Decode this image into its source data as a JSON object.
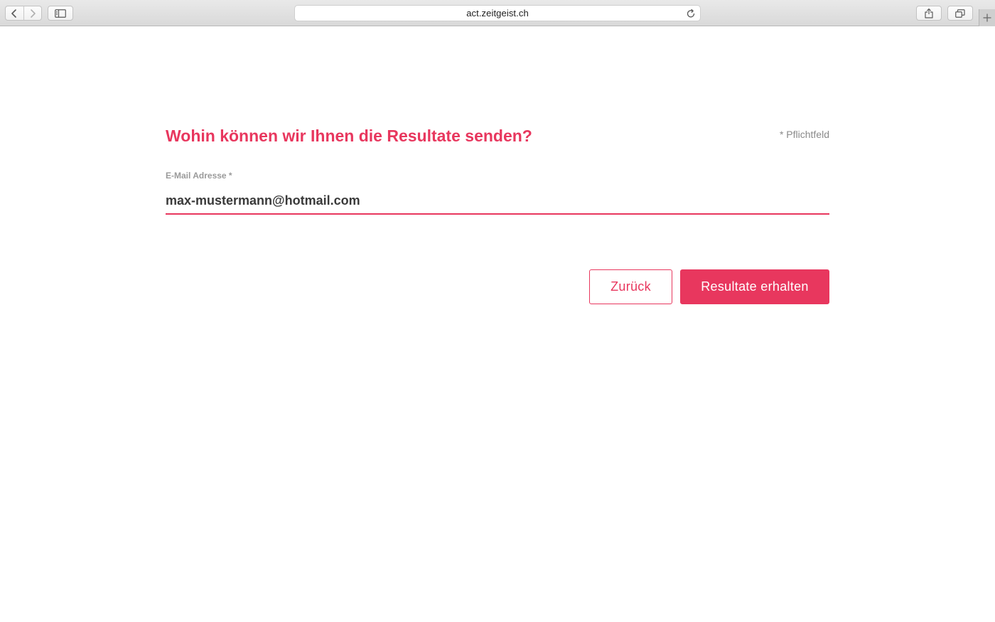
{
  "browser": {
    "url": "act.zeitgeist.ch"
  },
  "form": {
    "question": "Wohin können wir Ihnen die Resultate senden?",
    "required_note": "* Pflichtfeld",
    "email_label": "E-Mail Adresse *",
    "email_value": "max-mustermann@hotmail.com",
    "back_label": "Zurück",
    "submit_label": "Resultate erhalten"
  },
  "colors": {
    "accent": "#e8375e",
    "label_gray": "#9a9a9a",
    "text_dark": "#3a3a3a"
  },
  "icons": {
    "back": "chevron-left-icon",
    "forward": "chevron-right-icon",
    "sidebar": "sidebar-icon",
    "reload": "reload-icon",
    "share": "share-icon",
    "tabs": "tabs-overview-icon",
    "new_tab": "plus-icon"
  }
}
